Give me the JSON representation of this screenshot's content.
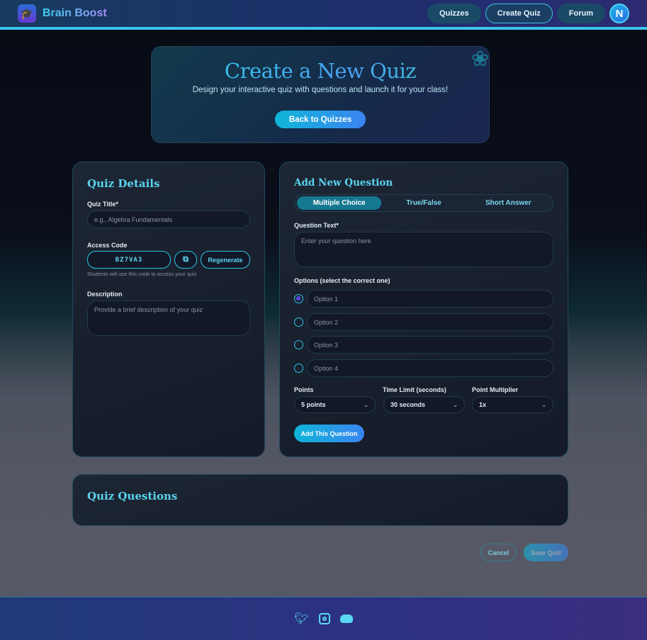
{
  "header": {
    "brand": "Brain Boost",
    "nav": [
      "Quizzes",
      "Create Quiz",
      "Forum"
    ],
    "avatar": "N"
  },
  "hero": {
    "title": "Create a New Quiz",
    "subtitle": "Design your interactive quiz with questions and launch it for your class!",
    "back": "Back to Quizzes"
  },
  "details": {
    "title": "Quiz Details",
    "quiz_title_label": "Quiz Title*",
    "quiz_title_placeholder": "e.g., Algebra Fundamentals",
    "access_label": "Access Code",
    "access_code": "BZ7VA3",
    "regenerate": "Regenerate",
    "access_hint": "Students will use this code to access your quiz",
    "description_label": "Description",
    "description_placeholder": "Provide a brief description of your quiz"
  },
  "question": {
    "title": "Add New Question",
    "tabs": [
      "Multiple Choice",
      "True/False",
      "Short Answer"
    ],
    "text_label": "Question Text*",
    "text_placeholder": "Enter your question here",
    "options_label": "Options (select the correct one)",
    "options": [
      "Option 1",
      "Option 2",
      "Option 3",
      "Option 4"
    ],
    "points_label": "Points",
    "points": "5 points",
    "time_label": "Time Limit (seconds)",
    "time": "30 seconds",
    "mult_label": "Point Multiplier",
    "mult": "1x",
    "add": "Add This Question"
  },
  "questions": {
    "title": "Quiz Questions"
  },
  "actions": {
    "cancel": "Cancel",
    "save": "Save Quiz"
  },
  "colors": {
    "accent": "#2cc4e4",
    "primary_gradient_start": "#0fb6d8",
    "primary_gradient_end": "#3a84f0"
  }
}
